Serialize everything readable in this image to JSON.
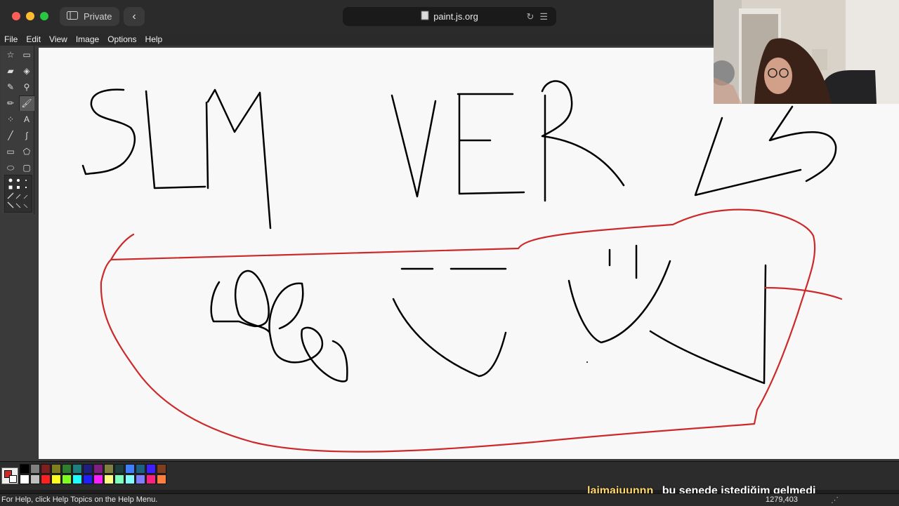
{
  "browser": {
    "private_label": "Private",
    "url": "paint.js.org"
  },
  "menu": [
    "File",
    "Edit",
    "View",
    "Image",
    "Options",
    "Help"
  ],
  "tools": [
    {
      "icon": "free-form-select-icon",
      "active": false
    },
    {
      "icon": "rect-select-icon",
      "active": false
    },
    {
      "icon": "eraser-icon",
      "active": false
    },
    {
      "icon": "fill-bucket-icon",
      "active": false
    },
    {
      "icon": "color-picker-icon",
      "active": false
    },
    {
      "icon": "magnifier-icon",
      "active": false
    },
    {
      "icon": "pencil-icon",
      "active": false
    },
    {
      "icon": "brush-icon",
      "active": true
    },
    {
      "icon": "airbrush-icon",
      "active": false
    },
    {
      "icon": "text-icon",
      "active": false
    },
    {
      "icon": "line-icon",
      "active": false
    },
    {
      "icon": "curve-icon",
      "active": false
    },
    {
      "icon": "rectangle-icon",
      "active": false
    },
    {
      "icon": "polygon-icon",
      "active": false
    },
    {
      "icon": "ellipse-icon",
      "active": false
    },
    {
      "icon": "rounded-rect-icon",
      "active": false
    }
  ],
  "colors": {
    "foreground": "#cc2a2a",
    "background": "#ffffff",
    "palette": [
      "#000000",
      "#7f7f7f",
      "#7f1f1f",
      "#7f7f1f",
      "#2f7f2f",
      "#1f7f7f",
      "#1f1f7f",
      "#7f1f7f",
      "#7f7f3f",
      "#1f3f3f",
      "#3f7fff",
      "#1f5f7f",
      "#3f1fff",
      "#7f3f1f",
      "#ffffff",
      "#bfbfbf",
      "#ff2020",
      "#ffff20",
      "#7fff20",
      "#20ffff",
      "#2020ff",
      "#ff20ff",
      "#ffff7f",
      "#7fffbf",
      "#7fffff",
      "#7f7fff",
      "#ff207f",
      "#ff7f3f"
    ]
  },
  "caption": {
    "name": "lajmajuunnn",
    "text": "bu senede istediğim gelmedi"
  },
  "status": {
    "help": "For Help, click Help Topics on the Help Menu.",
    "coords": "1279,403"
  }
}
